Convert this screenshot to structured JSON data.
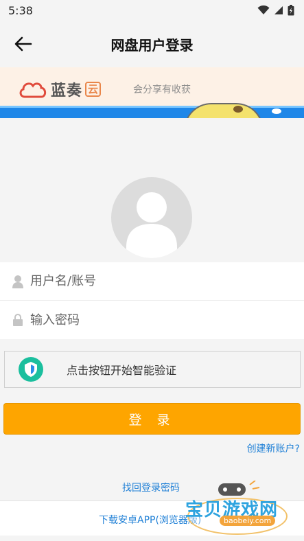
{
  "status_bar": {
    "time": "5:38"
  },
  "app_bar": {
    "title": "网盘用户登录"
  },
  "banner": {
    "brand": "蓝奏",
    "brand_badge": "云",
    "slogan": "会分享有收获"
  },
  "form": {
    "username_placeholder": "用户名/账号",
    "password_placeholder": "输入密码"
  },
  "captcha": {
    "label": "点击按钮开始智能验证"
  },
  "actions": {
    "login_label": "登 录",
    "create_account": "创建新账户?",
    "find_password": "找回登录密码",
    "download_app": "下载安卓APP(浏览器版)"
  },
  "watermark": {
    "text": "宝贝游戏网",
    "url": "baobeiy.com"
  },
  "colors": {
    "primary_button": "#fea500",
    "link": "#1e7fd6",
    "captcha_icon": "#1bbf9e"
  }
}
